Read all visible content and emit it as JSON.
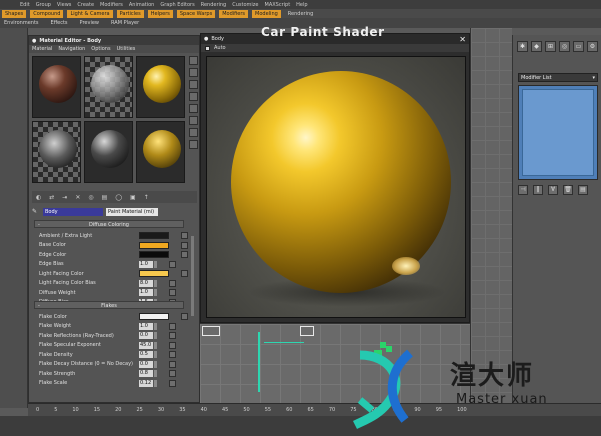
{
  "menu": {
    "items": [
      "Edit",
      "Group",
      "Views",
      "Create",
      "Modifiers",
      "Animation",
      "Graph Editors",
      "Rendering",
      "Customize",
      "MAXScript",
      "Help"
    ]
  },
  "toolbar": {
    "tabs": [
      "Shapes",
      "Compound",
      "Light & Camera",
      "Particles",
      "Helpers",
      "Space Warps",
      "Modifiers",
      "Modeling",
      "Rendering"
    ]
  },
  "secondary": {
    "items": [
      "Environments",
      "Effects",
      "Preview",
      "RAM Player"
    ]
  },
  "material_editor": {
    "title": "Material Editor - Body",
    "menu": [
      "Material",
      "Navigation",
      "Options",
      "Utilities"
    ],
    "material_name": "Body",
    "material_type": "Paint Material (mi)",
    "rollout_diffuse": "Diffuse Coloring",
    "rollout_flakes": "Flakes",
    "diffuse_params": [
      {
        "label": "Ambient / Extra Light",
        "kind": "color",
        "color": "#1a1a1a"
      },
      {
        "label": "Base Color",
        "kind": "color",
        "color": "#f0a820"
      },
      {
        "label": "Edge Color",
        "kind": "color",
        "color": "#0a0a0a"
      },
      {
        "label": "Edge Bias",
        "kind": "num",
        "value": "1.0"
      },
      {
        "label": "Light Facing Color",
        "kind": "color",
        "color": "#f6c84e"
      },
      {
        "label": "Light Facing Color Bias",
        "kind": "num",
        "value": "8.0"
      },
      {
        "label": "Diffuse Weight",
        "kind": "num",
        "value": "1.0"
      },
      {
        "label": "Diffuse Bias",
        "kind": "num",
        "value": "1.5"
      }
    ],
    "flakes_params": [
      {
        "label": "Flake Color",
        "kind": "color",
        "color": "#f2f2f2"
      },
      {
        "label": "Flake Weight",
        "kind": "num",
        "value": "1.0"
      },
      {
        "label": "Flake Reflections (Ray-Traced)",
        "kind": "num",
        "value": "0.0"
      },
      {
        "label": "Flake Specular Exponent",
        "kind": "num",
        "value": "45.0"
      },
      {
        "label": "Flake Density",
        "kind": "num",
        "value": "0.5"
      },
      {
        "label": "Flake Decay Distance (0 = No Decay)",
        "kind": "num",
        "value": "0.0"
      },
      {
        "label": "Flake Strength",
        "kind": "num",
        "value": "0.8"
      },
      {
        "label": "Flake Scale",
        "kind": "num",
        "value": "0.12"
      }
    ]
  },
  "render_window": {
    "title": "Body",
    "heading": "Car Paint Shader",
    "auto_label": "Auto"
  },
  "command_panel": {
    "modifier_list": "Modifier List"
  },
  "timeline": {
    "ticks": [
      "0",
      "5",
      "10",
      "15",
      "20",
      "25",
      "30",
      "35",
      "40",
      "45",
      "50",
      "55",
      "60",
      "65",
      "70",
      "75",
      "80",
      "85",
      "90",
      "95",
      "100"
    ]
  },
  "watermark": {
    "cn": "渲大师",
    "en": "Master xuan"
  }
}
